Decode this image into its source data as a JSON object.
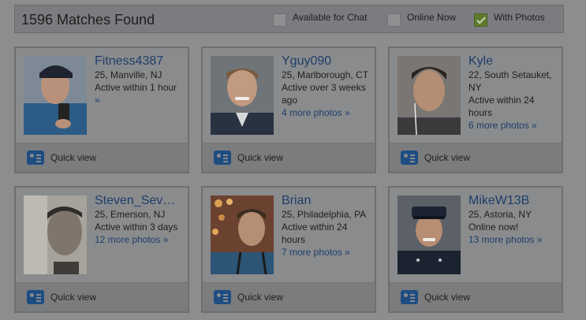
{
  "header": {
    "matches_text": "1596 Matches Found",
    "filters": [
      {
        "label": "Available for Chat",
        "checked": false
      },
      {
        "label": "Online Now",
        "checked": false
      },
      {
        "label": "With Photos",
        "checked": true
      }
    ]
  },
  "quick_view_label": "Quick view",
  "profiles": [
    {
      "name": "Fitness4387",
      "details": "25, Manville, NJ",
      "activity": "Active within 1 hour",
      "photos_link": "»"
    },
    {
      "name": "Yguy090",
      "details": "25, Marlborough, CT",
      "activity": "Active over 3 weeks ago",
      "photos_link": "4 more photos »"
    },
    {
      "name": "Kyle",
      "details": "22, South Setauket, NY",
      "activity": "Active within 24 hours",
      "photos_link": "6 more photos »"
    },
    {
      "name": "Steven_Sev…",
      "details": "25, Emerson, NJ",
      "activity": "Active within 3 days",
      "photos_link": "12 more photos »"
    },
    {
      "name": "Brian",
      "details": "25, Philadelphia, PA",
      "activity": "Active within 24 hours",
      "photos_link": "7 more photos »"
    },
    {
      "name": "MikeW13B",
      "details": "25, Astoria, NY",
      "activity": "Online now!",
      "photos_link": "13 more photos »"
    }
  ]
}
